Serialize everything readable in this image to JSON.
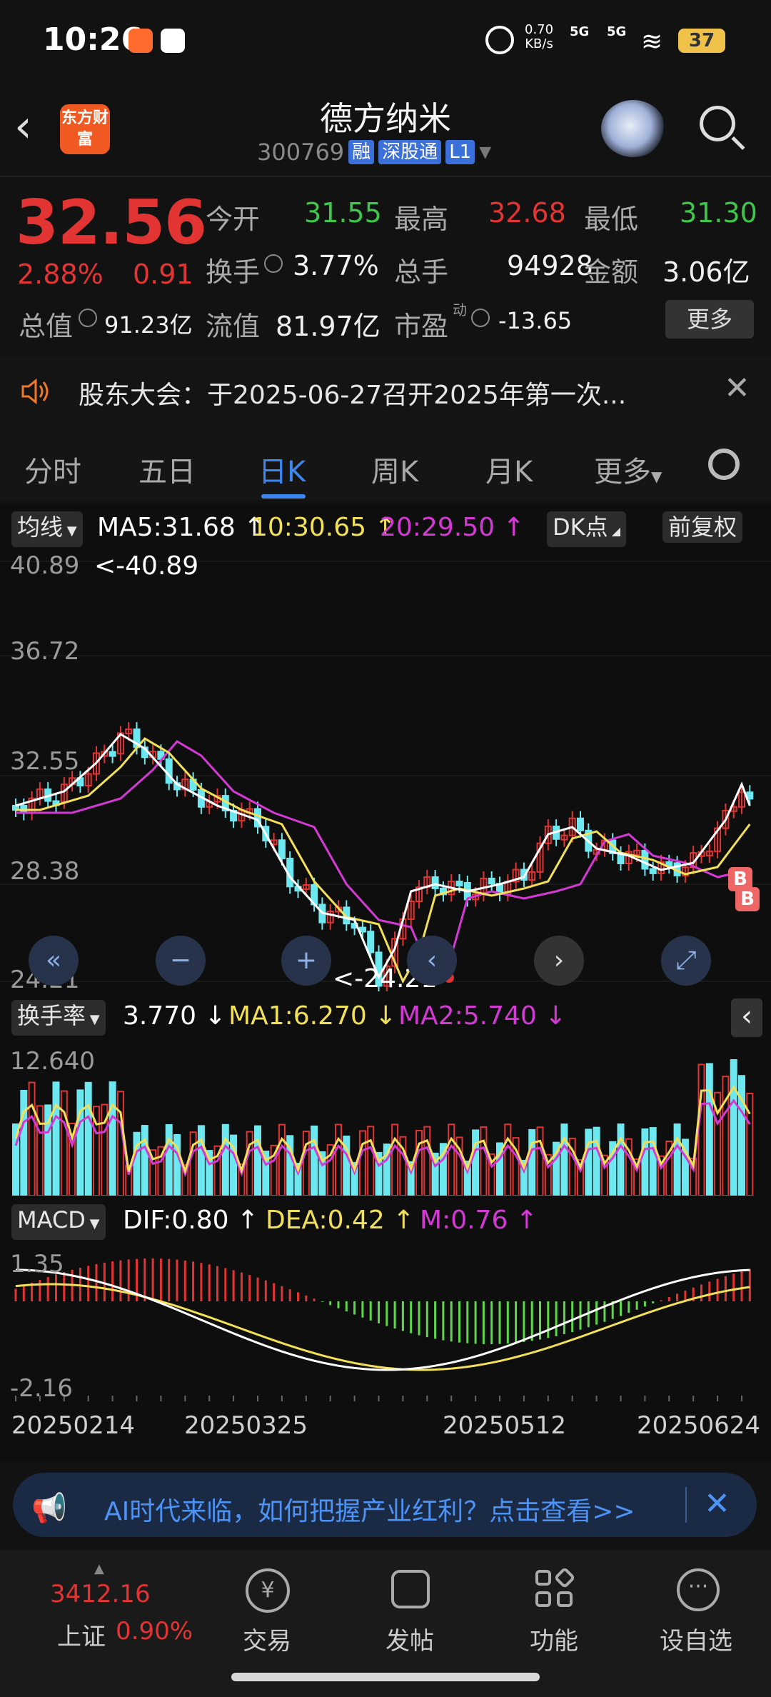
{
  "status_bar": {
    "time": "10:26",
    "net_speed_value": "0.70",
    "net_speed_unit": "KB/s",
    "signal1": "5G",
    "signal2": "5G",
    "battery": "37"
  },
  "header": {
    "app_logo_text": "东方财富",
    "stock_name": "德方纳米",
    "stock_code": "300769",
    "tags": [
      "融",
      "深股通",
      "L1"
    ]
  },
  "quote": {
    "price": "32.56",
    "change_pct": "2.88%",
    "change": "0.91",
    "open_label": "今开",
    "open": "31.55",
    "high_label": "最高",
    "high": "32.68",
    "low_label": "最低",
    "low": "31.30",
    "turnover_label": "换手",
    "turnover": "3.77%",
    "volume_label": "总手",
    "volume": "94928",
    "amount_label": "金额",
    "amount": "3.06亿",
    "mcap_label": "总值",
    "mcap": "91.23亿",
    "float_label": "流值",
    "float": "81.97亿",
    "pe_label": "市盈",
    "pe_sup": "动",
    "pe": "-13.65",
    "more": "更多"
  },
  "notice": {
    "text": "股东大会：于2025-06-27召开2025年第一次..."
  },
  "tabs": [
    "分时",
    "五日",
    "日K",
    "周K",
    "月K",
    "更多"
  ],
  "active_tab": 2,
  "kline": {
    "indicator_pill": "均线",
    "ma5": "MA5:31.68",
    "ma10": "10:30.65",
    "ma20": "20:29.50",
    "dk_pill": "DK点",
    "adjust_pill": "前复权",
    "axis": [
      "40.89",
      "36.72",
      "32.55",
      "28.38",
      "24.21"
    ],
    "high_marker": "<-40.89",
    "low_marker": "<-24.21",
    "badges": [
      "B",
      "B"
    ]
  },
  "turnover_chart": {
    "pill": "换手率",
    "value": "3.770",
    "ma1": "MA1:6.270",
    "ma2": "MA2:5.740",
    "axis_top": "12.640"
  },
  "macd_chart": {
    "pill": "MACD",
    "dif": "DIF:0.80",
    "dea": "DEA:0.42",
    "m": "M:0.76",
    "axis_top": "1.35",
    "axis_bottom": "-2.16"
  },
  "dates": [
    "20250214",
    "20250325",
    "20250512",
    "20250624"
  ],
  "ad": {
    "text": "AI时代来临，如何把握产业红利？点击查看>>"
  },
  "bottom_nav": {
    "index_value": "3412.16",
    "index_name": "上证",
    "index_pct": "0.90%",
    "items": [
      "交易",
      "发帖",
      "功能",
      "设自选"
    ]
  },
  "colors": {
    "up": "#e33434",
    "down": "#3ec74a",
    "accent": "#3d86f0",
    "ma5": "#ffffff",
    "ma10": "#f2e05a",
    "ma20": "#d33ad3",
    "candle_down": "#6ee8f0"
  },
  "icons": [
    "back-arrow-icon",
    "robot-avatar-icon",
    "search-icon",
    "speaker-icon",
    "close-icon",
    "settings-gear-icon",
    "megaphone-icon",
    "trade-icon",
    "post-icon",
    "function-icon",
    "watchlist-icon"
  ]
}
